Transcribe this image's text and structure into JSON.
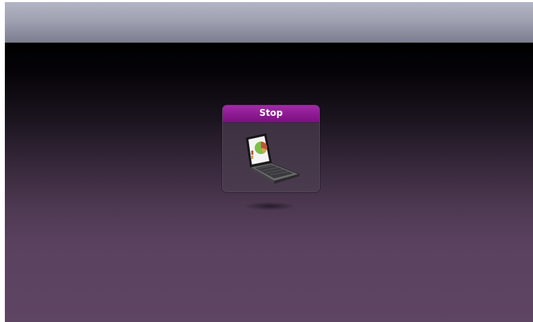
{
  "stop_tile": {
    "label": "Stop",
    "icon": "laptop-pie-chart-icon"
  },
  "colors": {
    "tile_header": "#8c1a92",
    "top_bar": "#a0a2b2",
    "background_bottom": "#5e4563"
  }
}
